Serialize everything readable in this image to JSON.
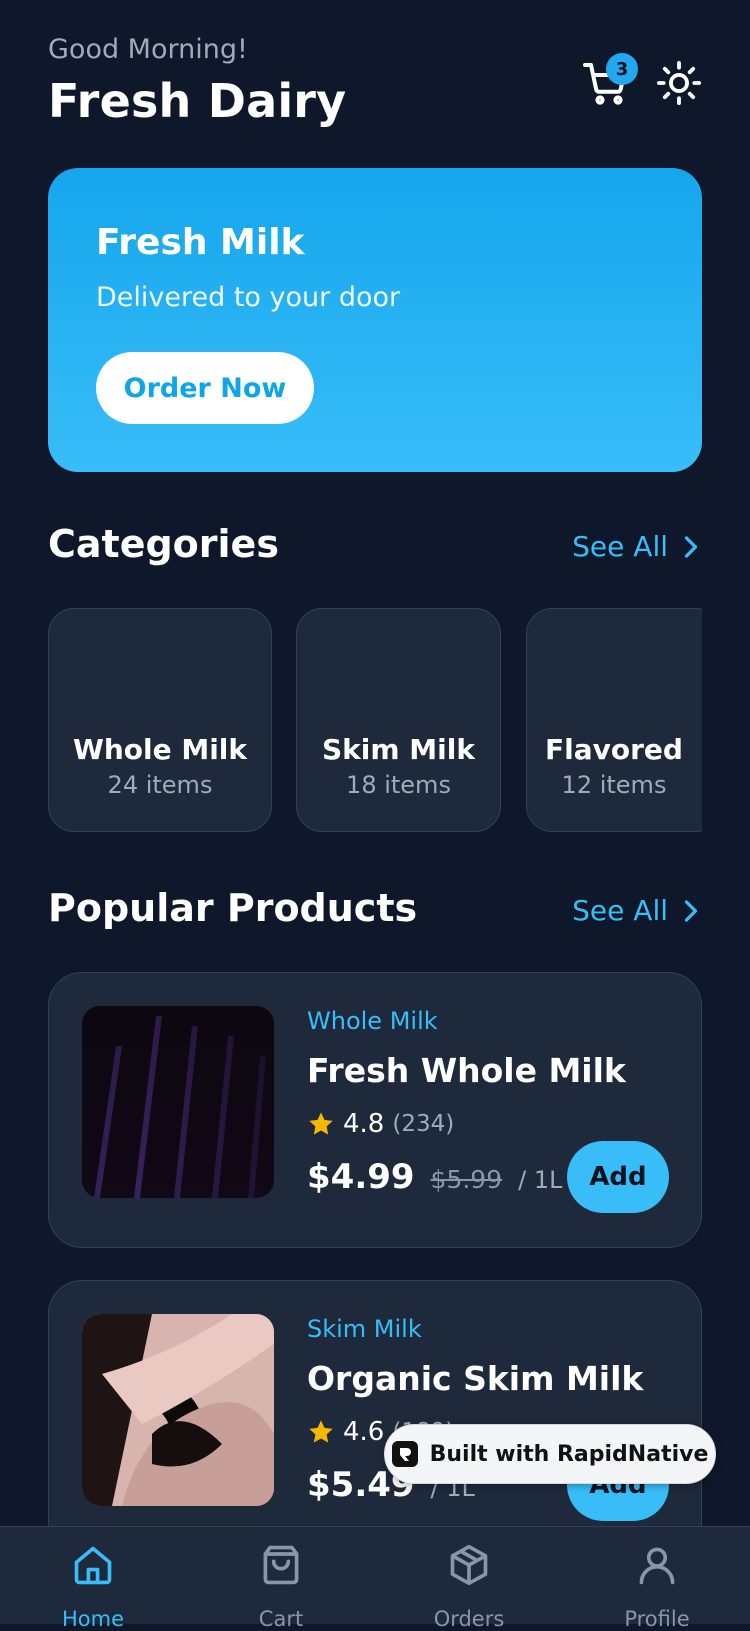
{
  "header": {
    "greeting": "Good Morning!",
    "title": "Fresh Dairy",
    "cart_count": "3",
    "cart_icon": "cart-icon",
    "theme_icon": "sun-icon"
  },
  "hero": {
    "title": "Fresh Milk",
    "subtitle": "Delivered to your door",
    "button": "Order Now"
  },
  "categories": {
    "title": "Categories",
    "see_all": "See All",
    "items": [
      {
        "name": "Whole Milk",
        "count": "24 items"
      },
      {
        "name": "Skim Milk",
        "count": "18 items"
      },
      {
        "name": "Flavored",
        "count": "12 items"
      }
    ]
  },
  "popular": {
    "title": "Popular Products",
    "see_all": "See All",
    "products": [
      {
        "category": "Whole Milk",
        "name": "Fresh Whole Milk",
        "rating": "4.8",
        "reviews": "(234)",
        "price": "$4.99",
        "old_price": "$5.99",
        "unit": "/ 1L",
        "button": "Add"
      },
      {
        "category": "Skim Milk",
        "name": "Organic Skim Milk",
        "rating": "4.6",
        "reviews": "(189)",
        "price": "$5.49",
        "old_price": "",
        "unit": "/ 1L",
        "button": "Add"
      }
    ]
  },
  "badge": {
    "label": "Built with RapidNative"
  },
  "nav": {
    "items": [
      {
        "label": "Home",
        "icon": "home-icon"
      },
      {
        "label": "Cart",
        "icon": "bag-icon"
      },
      {
        "label": "Orders",
        "icon": "box-icon"
      },
      {
        "label": "Profile",
        "icon": "user-icon"
      }
    ]
  },
  "colors": {
    "background": "#0f172a",
    "card": "#1e293b",
    "accent": "#38bdf8",
    "star": "#f5b700"
  }
}
